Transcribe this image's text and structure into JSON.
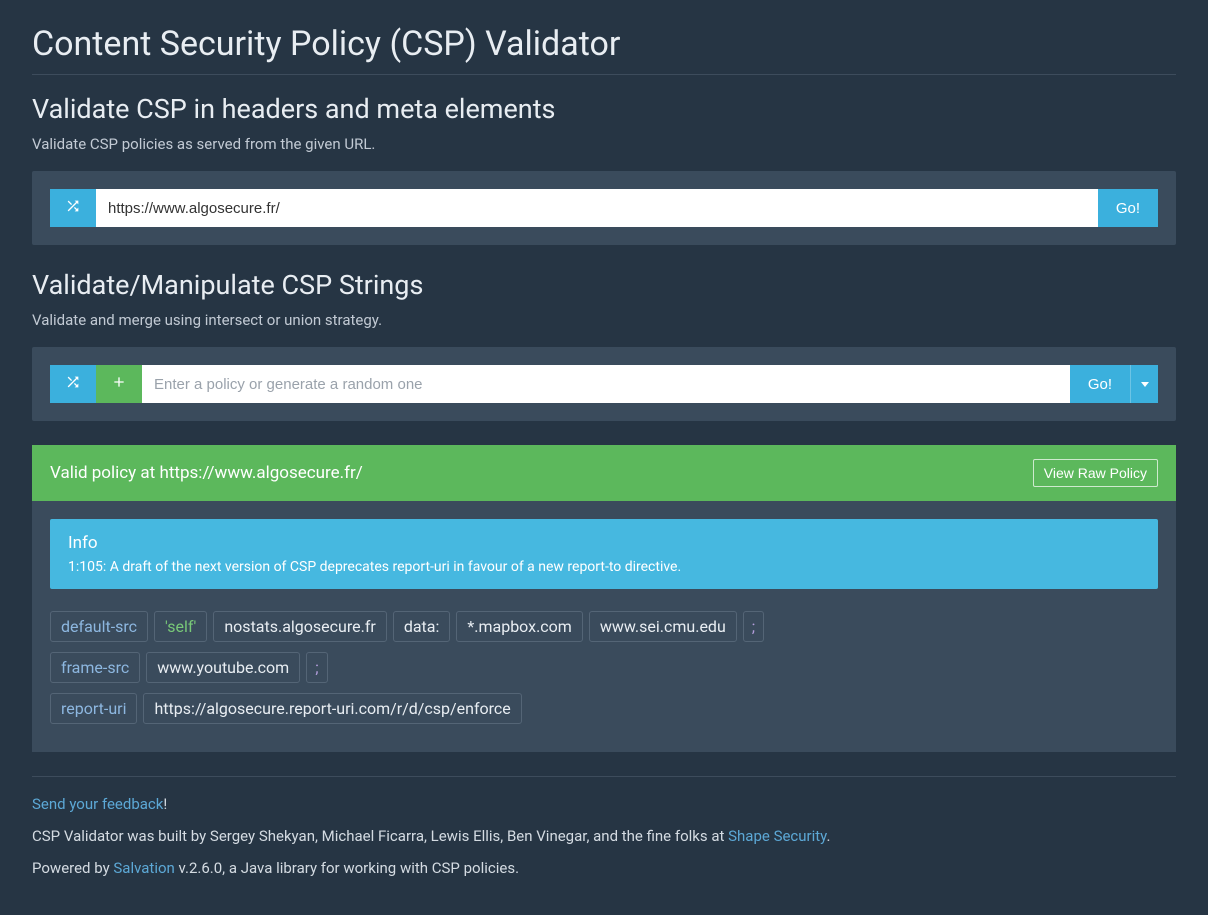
{
  "page_title": "Content Security Policy (CSP) Validator",
  "section1": {
    "heading": "Validate CSP in headers and meta elements",
    "subtext": "Validate CSP policies as served from the given URL.",
    "url_value": "https://www.algosecure.fr/",
    "go_label": "Go!"
  },
  "section2": {
    "heading": "Validate/Manipulate CSP Strings",
    "subtext": "Validate and merge using intersect or union strategy.",
    "placeholder": "Enter a policy or generate a random one",
    "go_label": "Go!"
  },
  "result": {
    "status_prefix": "Valid policy at ",
    "status_url": "https://www.algosecure.fr/",
    "view_raw_label": "View Raw Policy",
    "info_title": "Info",
    "info_message": "1:105: A draft of the next version of CSP deprecates report-uri in favour of a new report-to directive.",
    "directives": [
      {
        "name": "default-src",
        "values": [
          {
            "text": "'self'",
            "kind": "keyword"
          },
          {
            "text": "nostats.algosecure.fr",
            "kind": "value"
          },
          {
            "text": "data:",
            "kind": "value"
          },
          {
            "text": "*.mapbox.com",
            "kind": "value"
          },
          {
            "text": "www.sei.cmu.edu",
            "kind": "value"
          }
        ],
        "terminator": ";"
      },
      {
        "name": "frame-src",
        "values": [
          {
            "text": "www.youtube.com",
            "kind": "value"
          }
        ],
        "terminator": ";"
      },
      {
        "name": "report-uri",
        "values": [
          {
            "text": "https://algosecure.report-uri.com/r/d/csp/enforce",
            "kind": "value"
          }
        ],
        "terminator": ""
      }
    ]
  },
  "footer": {
    "feedback_link": "Send your feedback",
    "feedback_suffix": "!",
    "built_prefix": "CSP Validator was built by Sergey Shekyan, Michael Ficarra, Lewis Ellis, Ben Vinegar, and the fine folks at ",
    "built_link": "Shape Security",
    "built_suffix": ".",
    "powered_prefix": "Powered by ",
    "powered_link": "Salvation",
    "powered_suffix": " v.2.6.0, a Java library for working with CSP policies."
  }
}
